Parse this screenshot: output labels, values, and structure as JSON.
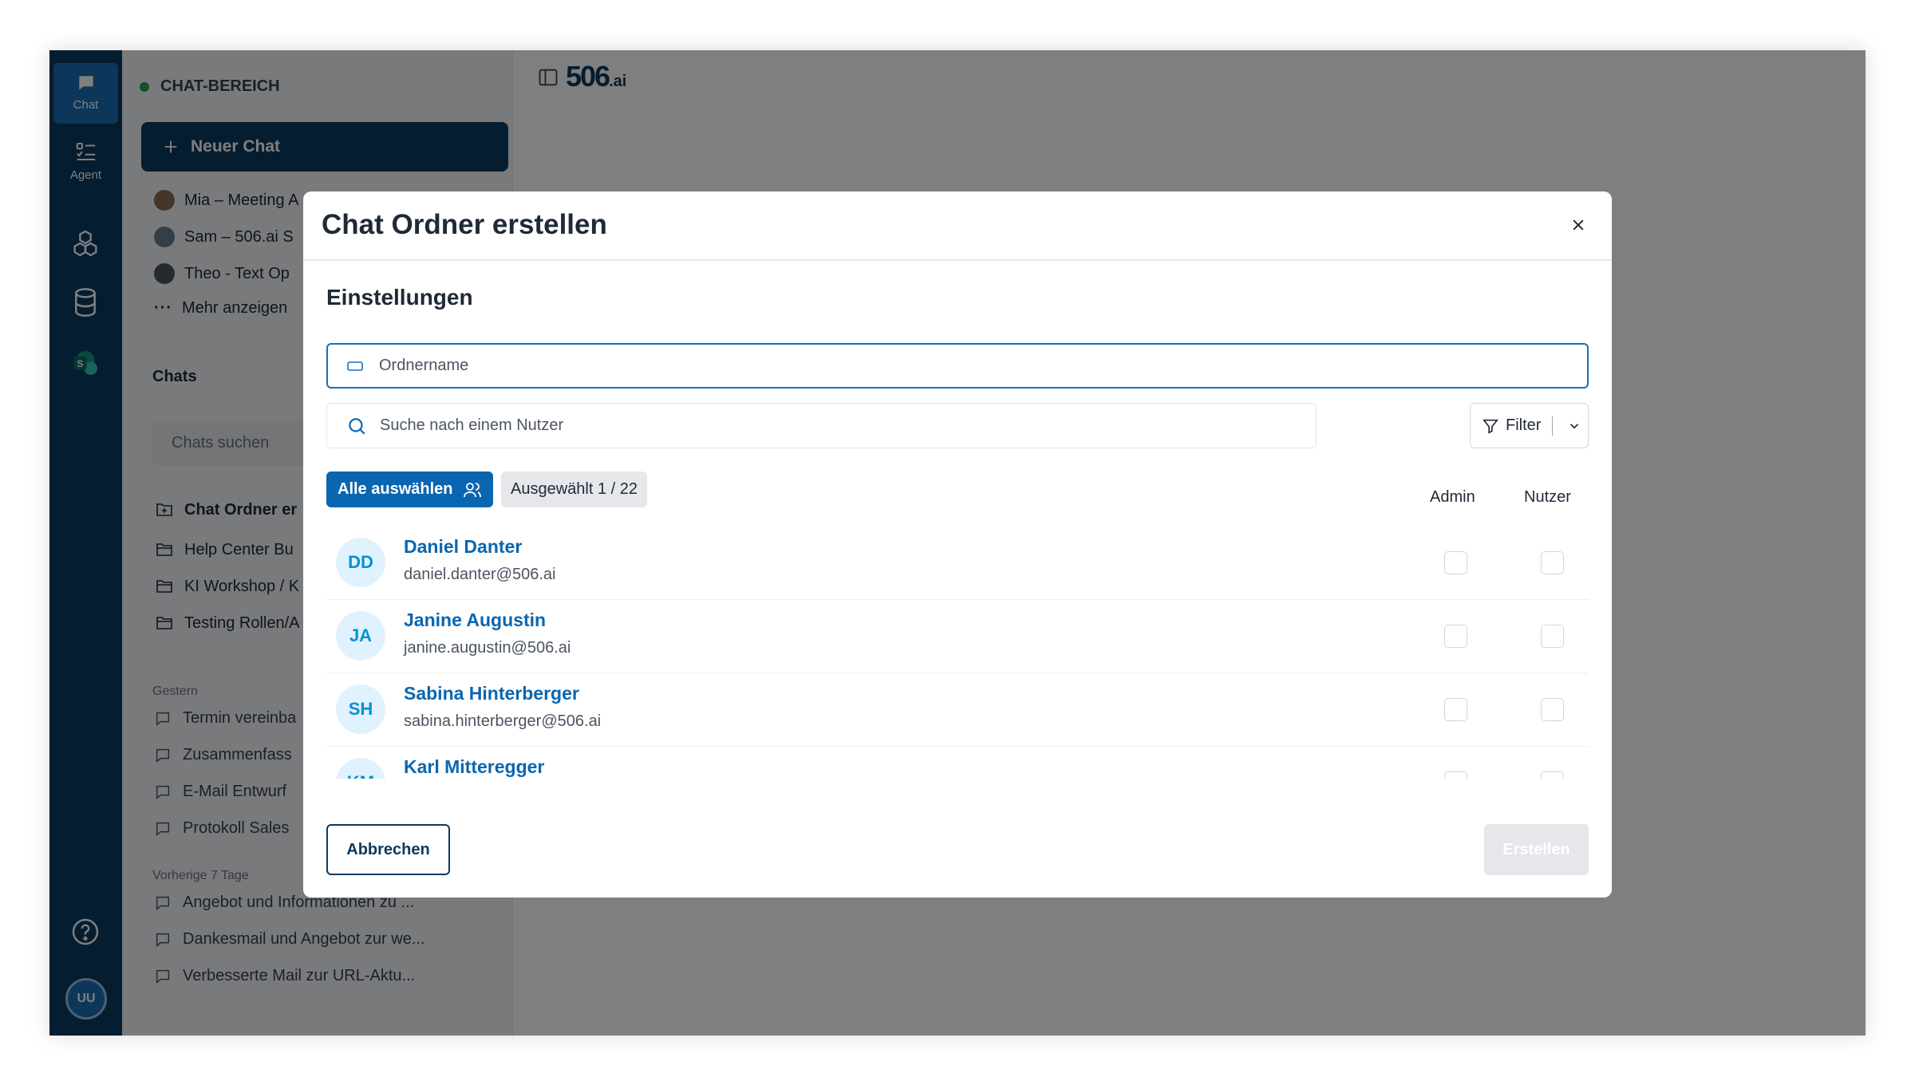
{
  "rail": {
    "chat_label": "Chat",
    "agent_label": "Agent",
    "user_initials": "UU"
  },
  "sidebar": {
    "header": "CHAT-BEREICH",
    "new_chat": "Neuer Chat",
    "pinned": [
      {
        "label": "Mia – Meeting A"
      },
      {
        "label": "Sam – 506.ai S"
      },
      {
        "label": "Theo - Text Op"
      }
    ],
    "more": "Mehr anzeigen",
    "chats_label": "Chats",
    "search_placeholder": "Chats suchen",
    "folders": [
      {
        "label": "Chat Ordner er"
      },
      {
        "label": "Help Center Bu"
      },
      {
        "label": "KI Workshop / K"
      },
      {
        "label": "Testing Rollen/A"
      }
    ],
    "groups": [
      {
        "label": "Gestern",
        "items": [
          "Termin vereinba",
          "Zusammenfass",
          "E-Mail Entwurf",
          "Protokoll Sales"
        ]
      },
      {
        "label": "Vorherige 7 Tage",
        "items": [
          "Angebot und Informationen zu ...",
          "Dankesmail und Angebot zur we...",
          "Verbesserte Mail zur URL-Aktu..."
        ]
      }
    ]
  },
  "main": {
    "logo_main": "506",
    "logo_suffix": ".ai"
  },
  "modal": {
    "title": "Chat Ordner erstellen",
    "section_title": "Einstellungen",
    "folder_name_placeholder": "Ordnername",
    "user_search_placeholder": "Suche nach einem Nutzer",
    "filter_label": "Filter",
    "select_all_label": "Alle auswählen",
    "selected_label": "Ausgewählt 1 / 22",
    "col_admin": "Admin",
    "col_user": "Nutzer",
    "users": [
      {
        "initials": "DD",
        "name": "Daniel Danter",
        "email": "daniel.danter@506.ai"
      },
      {
        "initials": "JA",
        "name": "Janine Augustin",
        "email": "janine.augustin@506.ai"
      },
      {
        "initials": "SH",
        "name": "Sabina Hinterberger",
        "email": "sabina.hinterberger@506.ai"
      },
      {
        "initials": "KM",
        "name": "Karl Mitteregger",
        "email": ""
      }
    ],
    "cancel_label": "Abbrechen",
    "create_label": "Erstellen"
  }
}
